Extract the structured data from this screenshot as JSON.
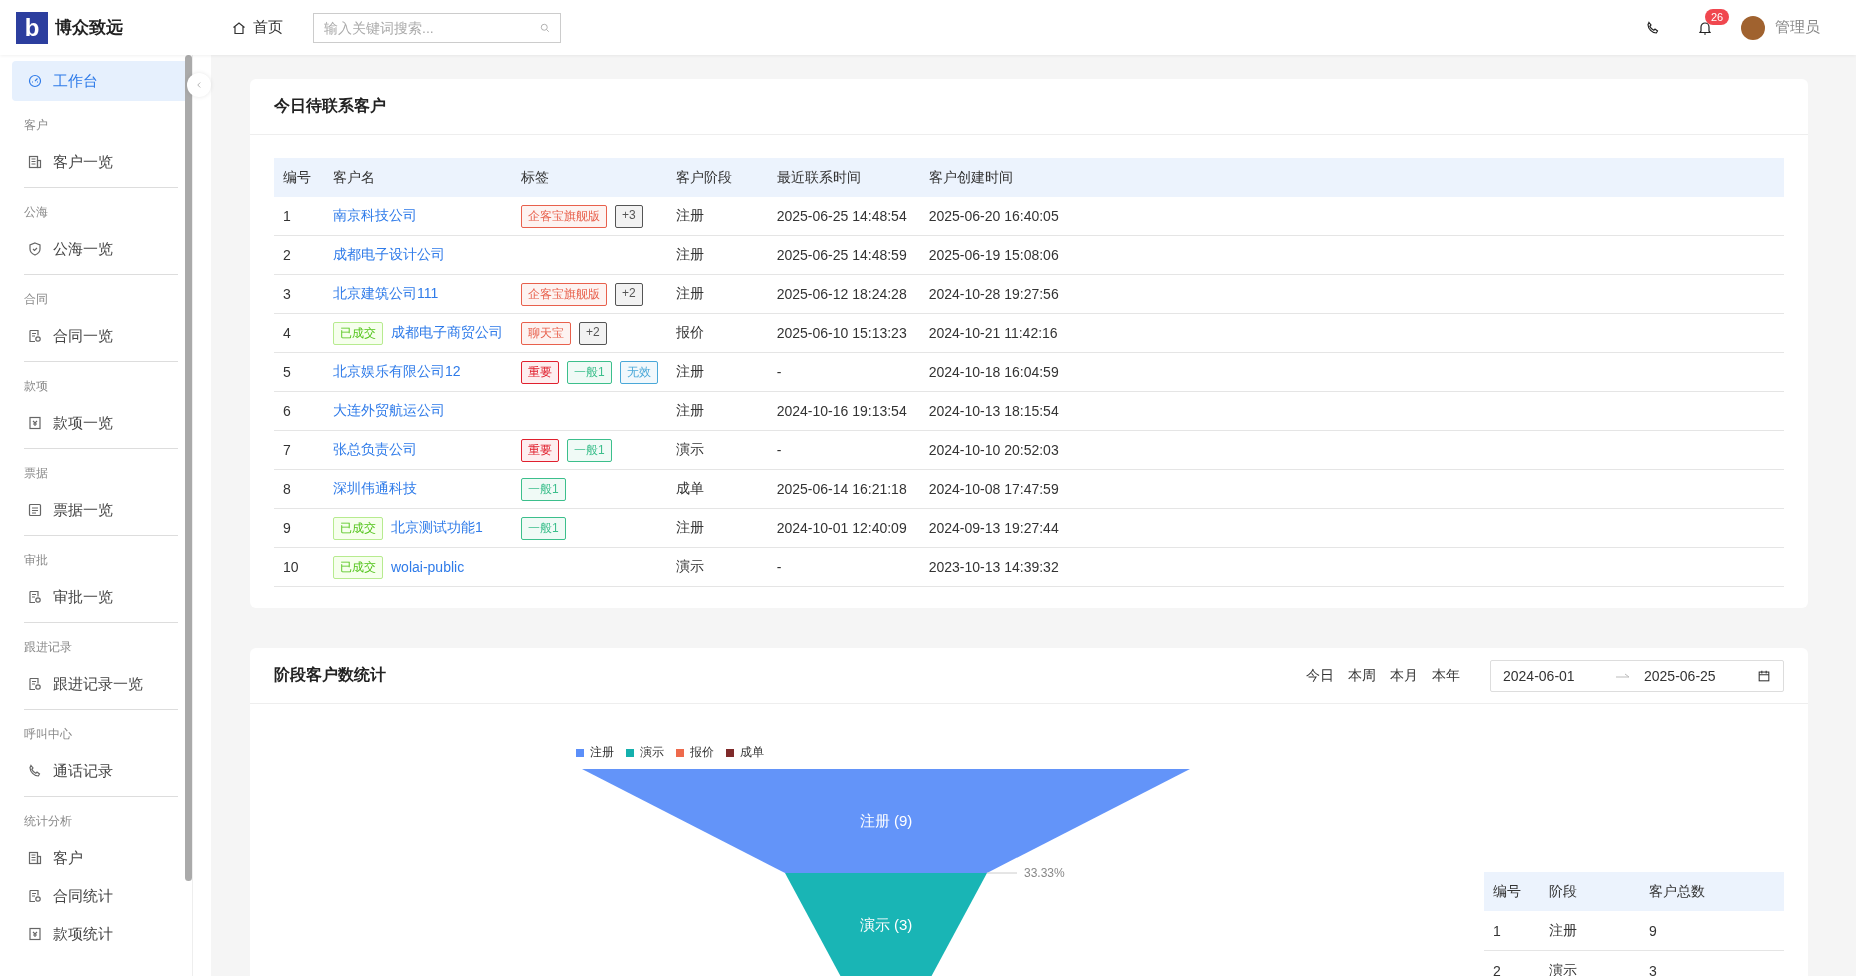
{
  "header": {
    "logo_mark": "b",
    "brand": "博众致远",
    "nav_home": "首页",
    "search": {
      "placeholder": "输入关键词搜索..."
    },
    "notification_count": "26",
    "user": "管理员"
  },
  "sidebar": {
    "items": [
      {
        "label": "工作台",
        "selected": true
      }
    ],
    "groups": [
      {
        "title": "客户",
        "items": [
          {
            "label": "客户一览",
            "selected": false
          }
        ]
      },
      {
        "title": "公海",
        "items": [
          {
            "label": "公海一览",
            "selected": false
          }
        ]
      },
      {
        "title": "合同",
        "items": [
          {
            "label": "合同一览",
            "selected": false
          }
        ]
      },
      {
        "title": "款项",
        "items": [
          {
            "label": "款项一览",
            "selected": false
          }
        ]
      },
      {
        "title": "票据",
        "items": [
          {
            "label": "票据一览",
            "selected": false
          }
        ]
      },
      {
        "title": "审批",
        "items": [
          {
            "label": "审批一览",
            "selected": false
          }
        ]
      },
      {
        "title": "跟进记录",
        "items": [
          {
            "label": "跟进记录一览",
            "selected": false
          }
        ]
      },
      {
        "title": "呼叫中心",
        "items": [
          {
            "label": "通话记录",
            "selected": false
          }
        ]
      },
      {
        "title": "统计分析",
        "items": [
          {
            "label": "客户",
            "selected": false
          },
          {
            "label": "合同统计",
            "selected": false
          },
          {
            "label": "款项统计",
            "selected": false
          }
        ]
      }
    ]
  },
  "contacts_card": {
    "title": "今日待联系客户",
    "columns": [
      "编号",
      "客户名",
      "标签",
      "客户阶段",
      "最近联系时间",
      "客户创建时间"
    ],
    "rows": [
      {
        "no": "1",
        "name": "南京科技公司",
        "tags": [
          {
            "text": "企客宝旗舰版",
            "color": "#e8604c"
          },
          {
            "text": "+3",
            "color": "#555555"
          }
        ],
        "stage": "注册",
        "last_contact": "2025-06-25 14:48:54",
        "created": "2025-06-20 16:40:05"
      },
      {
        "no": "2",
        "name": "成都电子设计公司",
        "tags": [],
        "stage": "注册",
        "last_contact": "2025-06-25 14:48:59",
        "created": "2025-06-19 15:08:06"
      },
      {
        "no": "3",
        "name": "北京建筑公司111",
        "tags": [
          {
            "text": "企客宝旗舰版",
            "color": "#e8604c"
          },
          {
            "text": "+2",
            "color": "#555555"
          }
        ],
        "stage": "注册",
        "last_contact": "2025-06-12 18:24:28",
        "created": "2024-10-28 19:27:56"
      },
      {
        "no": "4",
        "badge": "已成交",
        "name": "成都电子商贸公司",
        "tags": [
          {
            "text": "聊天宝",
            "color": "#e8604c"
          },
          {
            "text": "+2",
            "color": "#555555"
          }
        ],
        "stage": "报价",
        "last_contact": "2025-06-10 15:13:23",
        "created": "2024-10-21 11:42:16"
      },
      {
        "no": "5",
        "name": "北京娱乐有限公司12",
        "tags": [
          {
            "text": "重要",
            "color": "#e0202e"
          },
          {
            "text": "一般1",
            "color": "#3cbf8c"
          },
          {
            "text": "无效",
            "color": "#4aa8d8"
          }
        ],
        "stage": "注册",
        "last_contact": "-",
        "created": "2024-10-18 16:04:59"
      },
      {
        "no": "6",
        "name": "大连外贸航运公司",
        "tags": [],
        "stage": "注册",
        "last_contact": "2024-10-16 19:13:54",
        "created": "2024-10-13 18:15:54"
      },
      {
        "no": "7",
        "name": "张总负责公司",
        "tags": [
          {
            "text": "重要",
            "color": "#e0202e"
          },
          {
            "text": "一般1",
            "color": "#3cbf8c"
          }
        ],
        "stage": "演示",
        "last_contact": "-",
        "created": "2024-10-10 20:52:03"
      },
      {
        "no": "8",
        "name": "深圳伟通科技",
        "tags": [
          {
            "text": "一般1",
            "color": "#3cbf8c"
          }
        ],
        "stage": "成单",
        "last_contact": "2025-06-14 16:21:18",
        "created": "2024-10-08 17:47:59"
      },
      {
        "no": "9",
        "badge": "已成交",
        "name": "北京测试功能1",
        "tags": [
          {
            "text": "一般1",
            "color": "#3cbf8c"
          }
        ],
        "stage": "注册",
        "last_contact": "2024-10-01 12:40:09",
        "created": "2024-09-13 19:27:44"
      },
      {
        "no": "10",
        "badge": "已成交",
        "name": "wolai-public",
        "tags": [],
        "stage": "演示",
        "last_contact": "-",
        "created": "2023-10-13 14:39:32"
      }
    ]
  },
  "stats_card": {
    "title": "阶段客户数统计",
    "ranges": [
      "今日",
      "本周",
      "本月",
      "本年"
    ],
    "date_start": "2024-06-01",
    "date_end": "2025-06-25",
    "legend": [
      {
        "label": "注册",
        "color": "#5b8ff9"
      },
      {
        "label": "演示",
        "color": "#14b0ad"
      },
      {
        "label": "报价",
        "color": "#ee6a4c"
      },
      {
        "label": "成单",
        "color": "#7f2a2a"
      }
    ],
    "funnel": [
      {
        "label": "注册 (9)",
        "color": "#6394f9"
      },
      {
        "label": "演示 (3)",
        "color": "#19b5b5"
      }
    ],
    "conversions": [
      "33.33%"
    ],
    "table": {
      "columns": [
        "编号",
        "阶段",
        "客户总数"
      ],
      "rows": [
        [
          "1",
          "注册",
          "9"
        ],
        [
          "2",
          "演示",
          "3"
        ]
      ]
    }
  }
}
